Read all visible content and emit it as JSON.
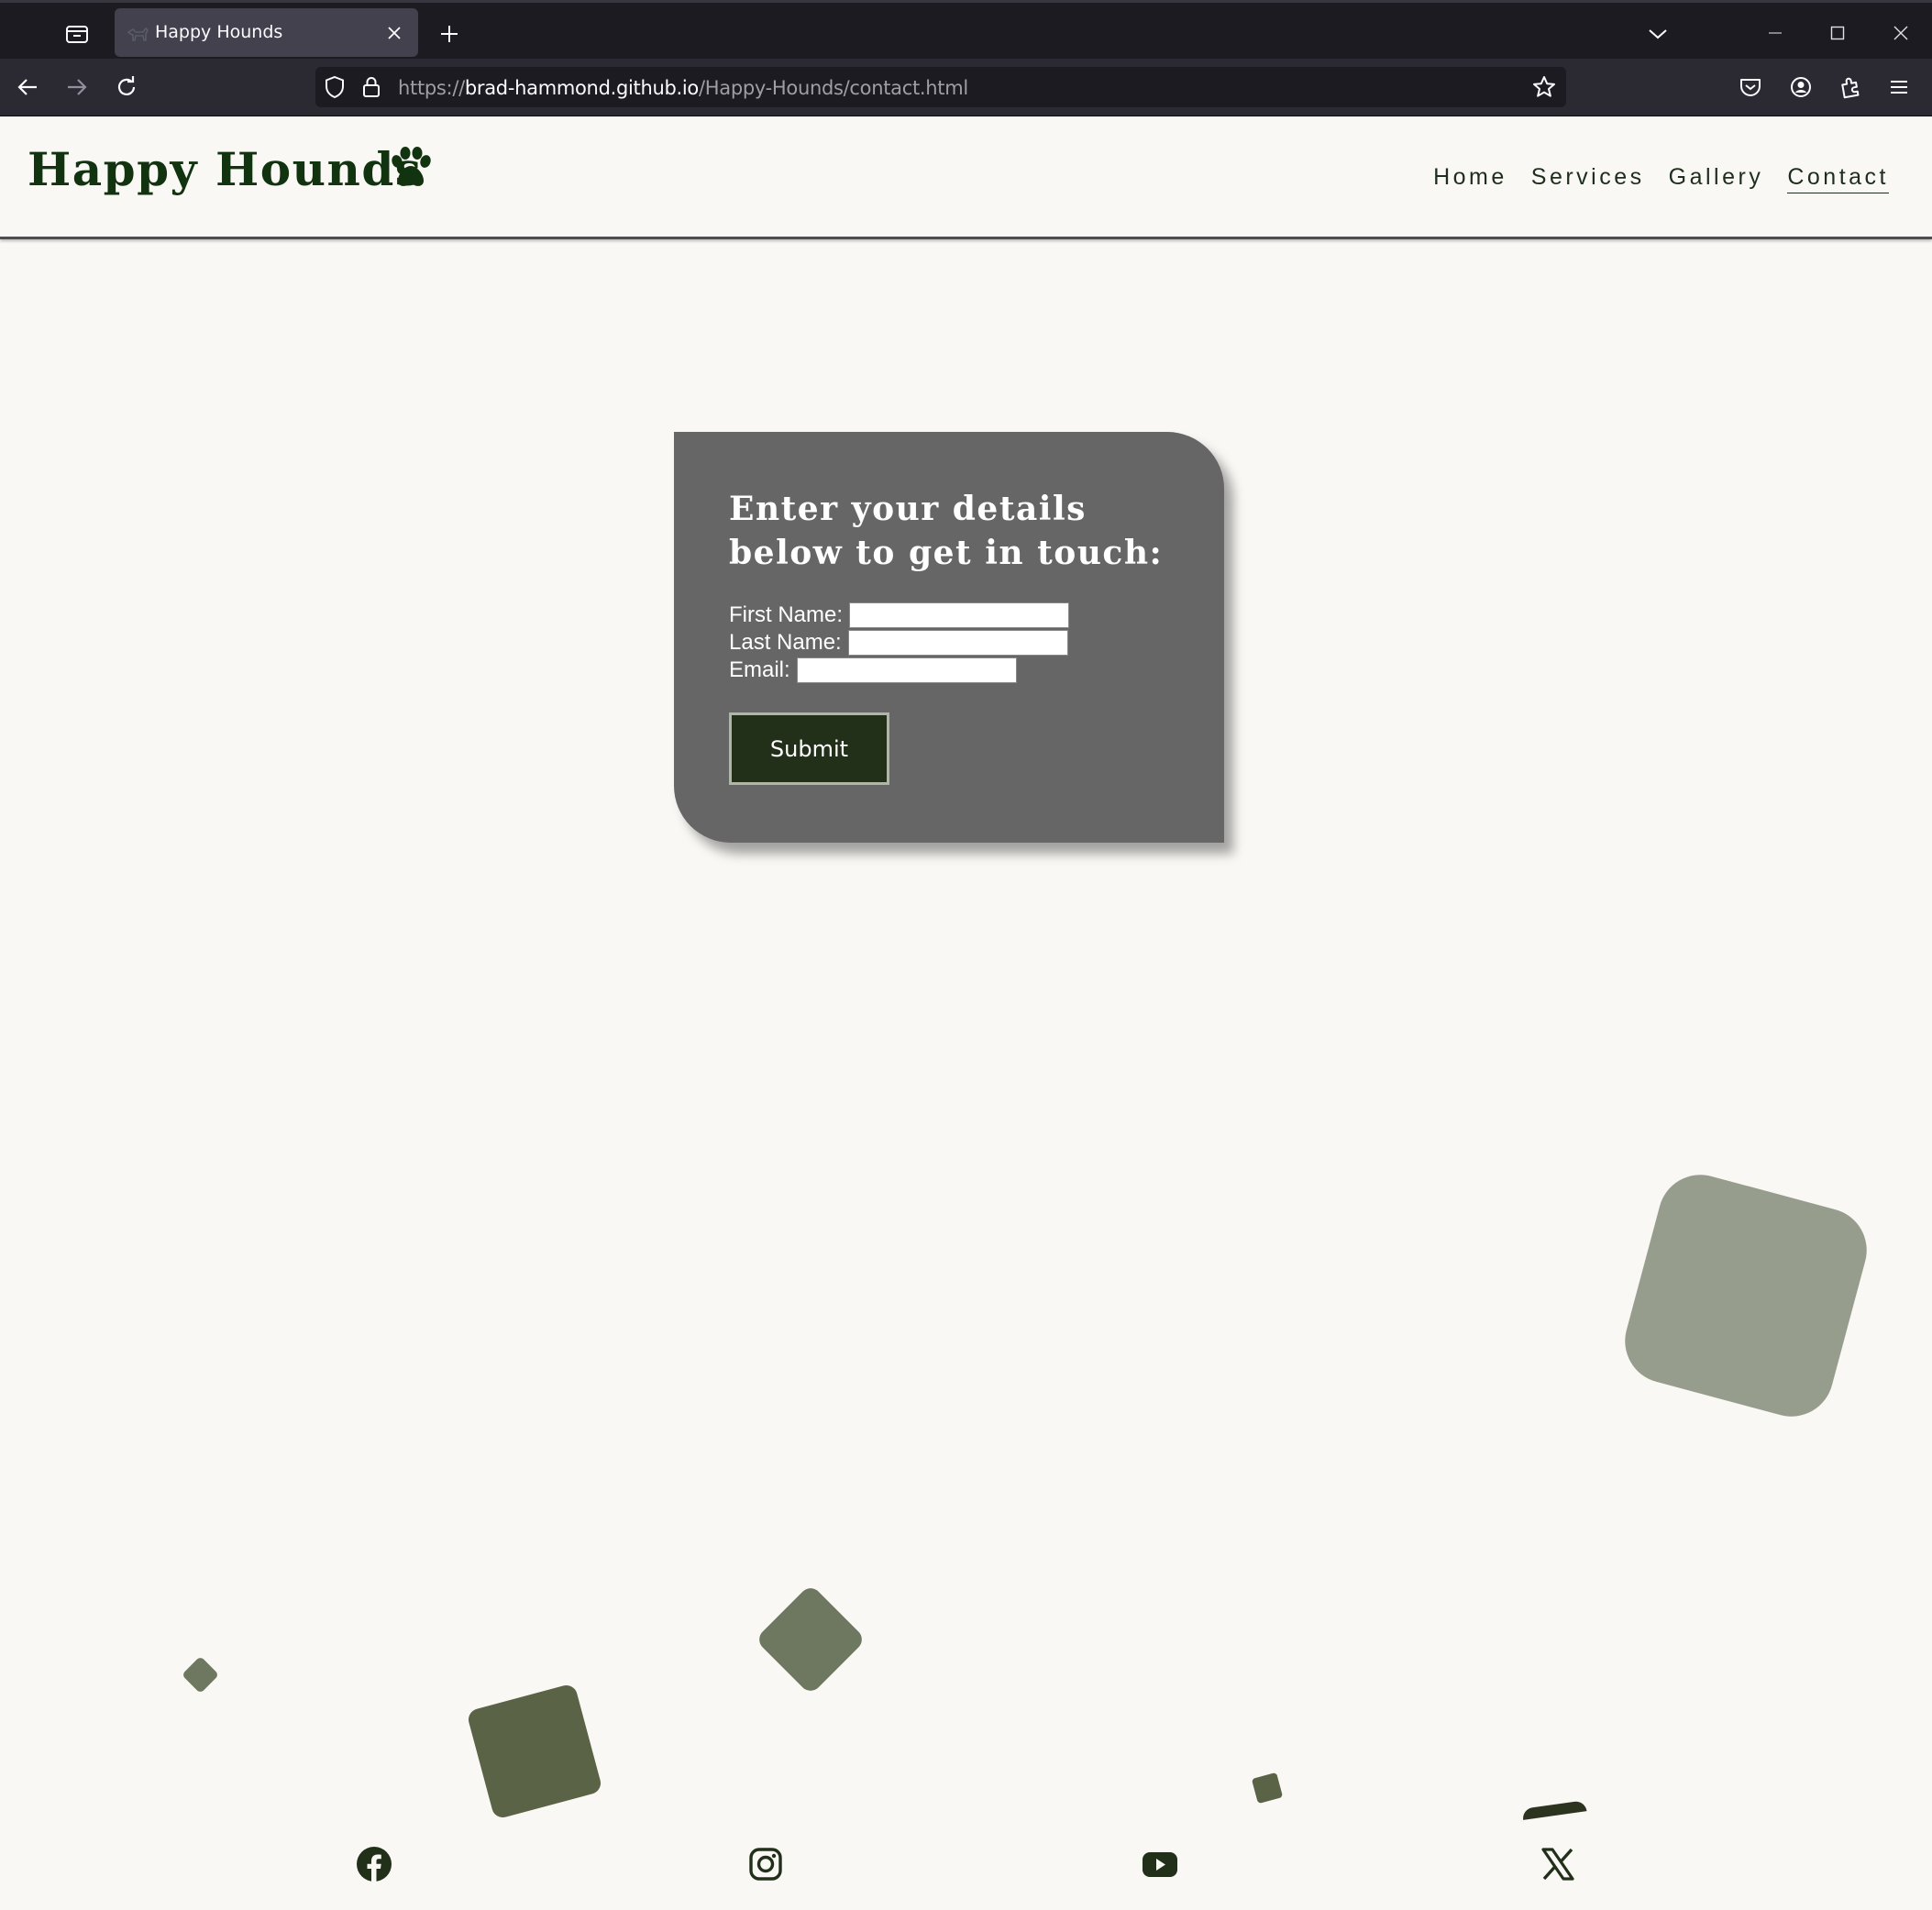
{
  "browser": {
    "tab": {
      "title": "Happy Hounds"
    },
    "url": {
      "scheme": "https://",
      "host": "brad-hammond.github.io",
      "path": "/Happy-Hounds/contact.html"
    },
    "icons": {
      "tab_list": "tab-list-icon",
      "favicon": "dog-favicon-icon",
      "close_tab": "close-icon",
      "new_tab": "plus-icon",
      "list_all_tabs": "chevron-down-icon",
      "minimize": "minimize-icon",
      "maximize": "maximize-icon",
      "close_window": "close-icon",
      "back": "back-arrow-icon",
      "forward": "forward-arrow-icon",
      "reload": "reload-icon",
      "tracking": "shield-icon",
      "security": "lock-icon",
      "bookmark": "star-icon",
      "pocket": "pocket-icon",
      "account": "account-icon",
      "extensions": "extensions-icon",
      "menu": "hamburger-menu-icon"
    }
  },
  "site": {
    "logo": "Happy Hounds",
    "logo_icon": "paw-icon",
    "nav": [
      {
        "label": "Home"
      },
      {
        "label": "Services"
      },
      {
        "label": "Gallery"
      },
      {
        "label": "Contact",
        "active": true
      }
    ],
    "colors": {
      "brand_dark": "#12330f",
      "card_bg": "#666666",
      "button_bg": "#22301a",
      "page_bg": "#f9f8f5"
    }
  },
  "contact": {
    "heading": "Enter your details below to get in touch:",
    "first_name_label": "First Name:",
    "first_name_value": "",
    "last_name_label": "Last Name:",
    "last_name_value": "",
    "email_label": "Email:",
    "email_value": "",
    "submit_label": "Submit"
  },
  "footer": {
    "social": [
      "facebook-icon",
      "instagram-icon",
      "youtube-icon",
      "x-icon"
    ]
  }
}
